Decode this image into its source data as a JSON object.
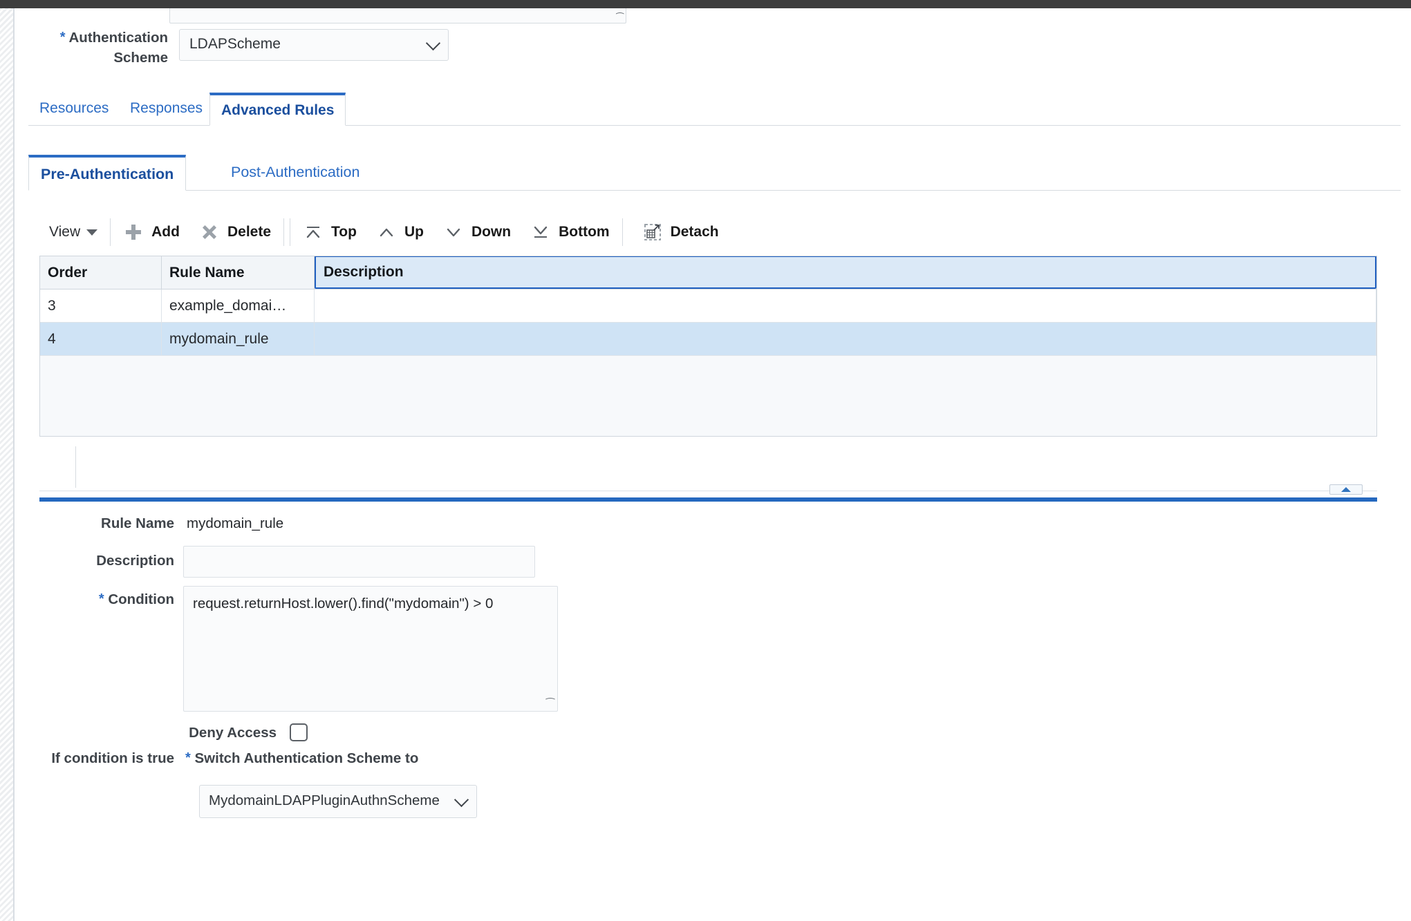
{
  "auth_scheme": {
    "label": "Authentication Scheme",
    "required_marker": "*",
    "value": "LDAPScheme"
  },
  "tabs": [
    {
      "label": "Resources",
      "active": false
    },
    {
      "label": "Responses",
      "active": false
    },
    {
      "label": "Advanced Rules",
      "active": true
    }
  ],
  "subtabs": [
    {
      "label": "Pre-Authentication",
      "active": true
    },
    {
      "label": "Post-Authentication",
      "active": false
    }
  ],
  "toolbar": {
    "view_label": "View",
    "add_label": "Add",
    "delete_label": "Delete",
    "top_label": "Top",
    "up_label": "Up",
    "down_label": "Down",
    "bottom_label": "Bottom",
    "detach_label": "Detach"
  },
  "table": {
    "columns": [
      "Order",
      "Rule Name",
      "Description"
    ],
    "rows": [
      {
        "order": "3",
        "rule_name": "example_domai…",
        "description": "",
        "selected": false
      },
      {
        "order": "4",
        "rule_name": "mydomain_rule",
        "description": "",
        "selected": true
      }
    ]
  },
  "detail": {
    "rule_name_label": "Rule Name",
    "rule_name_value": "mydomain_rule",
    "description_label": "Description",
    "description_value": "",
    "description_placeholder": "",
    "condition_label": "Condition",
    "condition_required_marker": "*",
    "condition_value": "request.returnHost.lower().find(\"mydomain\") > 0",
    "deny_access_label": "Deny Access",
    "deny_access_checked": false,
    "if_condition_label": "If condition is true",
    "switch_scheme_label": "Switch Authentication Scheme to",
    "switch_scheme_required_marker": "*",
    "switch_scheme_value": "MydomainLDAPPluginAuthnScheme"
  },
  "colors": {
    "accent": "#2c6cc4",
    "active_tab_border": "#2568bf",
    "selected_row": "#cfe3f5",
    "selected_header": "#dbe9f7",
    "top_strip": "#3d3d3d"
  }
}
